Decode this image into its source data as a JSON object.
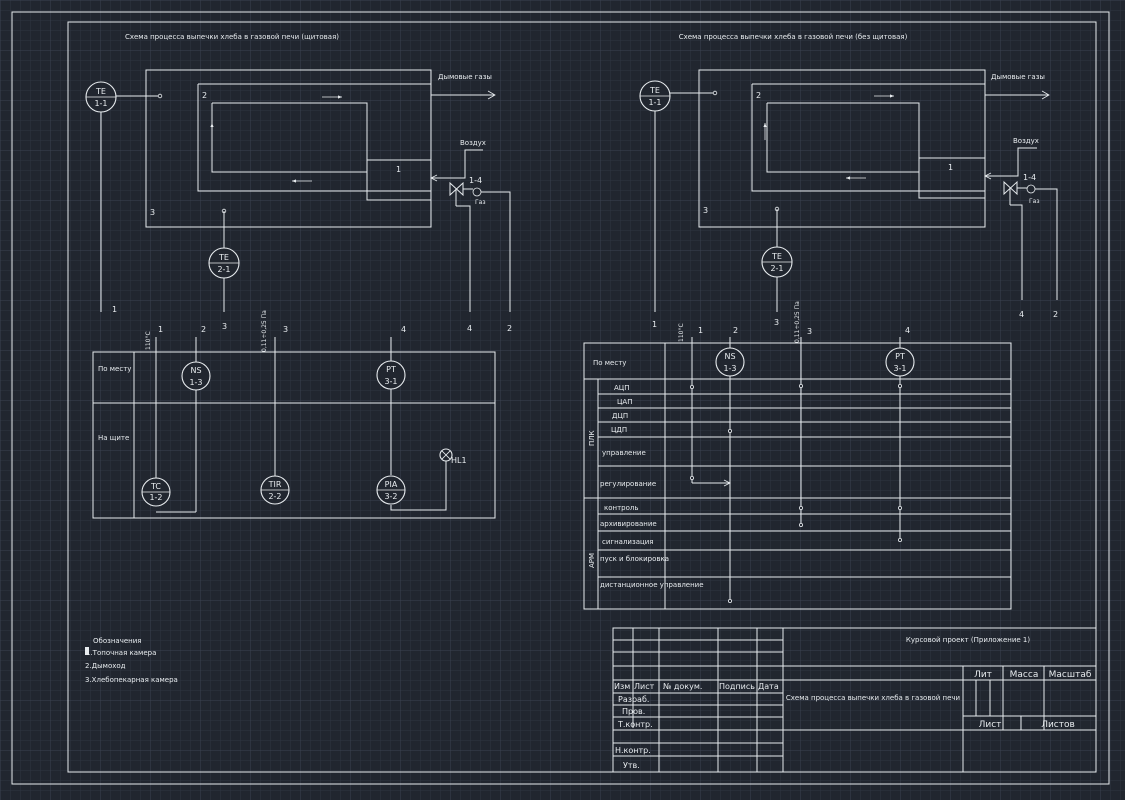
{
  "colors": {
    "background": "#21262f",
    "grid": "#2e3542",
    "grid_major": "#3a4250",
    "lines": "#e8ecef"
  },
  "left_scheme": {
    "title": "Схема процесса выпечки хлеба в газовой печи (щитовая)",
    "flue_gas_label": "Дымовые газы",
    "air_label": "Воздух",
    "gas_label": "Газ",
    "zone_1": "1",
    "zone_2": "2",
    "zone_3": "3",
    "valve_tag": "1-4",
    "instruments": {
      "te11": {
        "code": "TE",
        "num": "1-1"
      },
      "te21": {
        "code": "TE",
        "num": "2-1"
      },
      "ns13": {
        "code": "NS",
        "num": "1-3"
      },
      "pt31": {
        "code": "PT",
        "num": "3-1"
      },
      "tc12": {
        "code": "TC",
        "num": "1-2"
      },
      "tir22": {
        "code": "TIR",
        "num": "2-2"
      },
      "pia32": {
        "code": "PIA",
        "num": "3-2"
      }
    },
    "lamp_label": "HL1",
    "line_numbers": [
      "1",
      "3",
      "4",
      "2"
    ],
    "column_numbers": [
      "1",
      "2",
      "3",
      "4"
    ],
    "range_temp": "110°С",
    "range_pressure": "0,11÷0,25 Па",
    "row_local": "По месту",
    "row_panel": "На щите"
  },
  "right_scheme": {
    "title": "Схема процесса выпечки хлеба в газовой печи (без щитовая)",
    "flue_gas_label": "Дымовые газы",
    "air_label": "Воздух",
    "gas_label": "Газ",
    "zone_1": "1",
    "zone_2": "2",
    "zone_3": "3",
    "valve_tag": "1-4",
    "instruments": {
      "te11": {
        "code": "TE",
        "num": "1-1"
      },
      "te21": {
        "code": "TE",
        "num": "2-1"
      },
      "ns13": {
        "code": "NS",
        "num": "1-3"
      },
      "pt31": {
        "code": "PT",
        "num": "3-1"
      }
    },
    "line_numbers": [
      "1",
      "3",
      "4",
      "2"
    ],
    "column_numbers": [
      "1",
      "2",
      "3",
      "4"
    ],
    "range_temp": "110°С",
    "range_pressure": "0,11÷0,25 Па",
    "row_local": "По месту",
    "group_plc": "ПЛК",
    "group_arm": "АРМ",
    "plc_rows": [
      "АЦП",
      "ЦАП",
      "ДЦП",
      "ЦДП",
      "управление",
      "регулирование"
    ],
    "arm_rows": [
      "контроль",
      "архивирование",
      "сигнализация",
      "пуск и блокировка",
      "дистанционное управление"
    ]
  },
  "legend": {
    "heading": "Обозначения",
    "items": [
      "1.Топочная камера",
      "2.Дымоход",
      "3.Хлебопекарная камера"
    ]
  },
  "title_block": {
    "project": "Курсовой проект (Приложение 1)",
    "drawing_name": "Схема процесса выпечки хлеба в газовой печи",
    "col_headers": [
      "Изм",
      "Лист",
      "№ докум.",
      "Подпись",
      "Дата"
    ],
    "row_labels": [
      "Разраб.",
      "Пров.",
      "Т.контр.",
      "Н.контр.",
      "Утв."
    ],
    "lit": "Лит",
    "mass": "Масса",
    "scale": "Масштаб",
    "sheet": "Лист",
    "sheets": "Листов"
  }
}
